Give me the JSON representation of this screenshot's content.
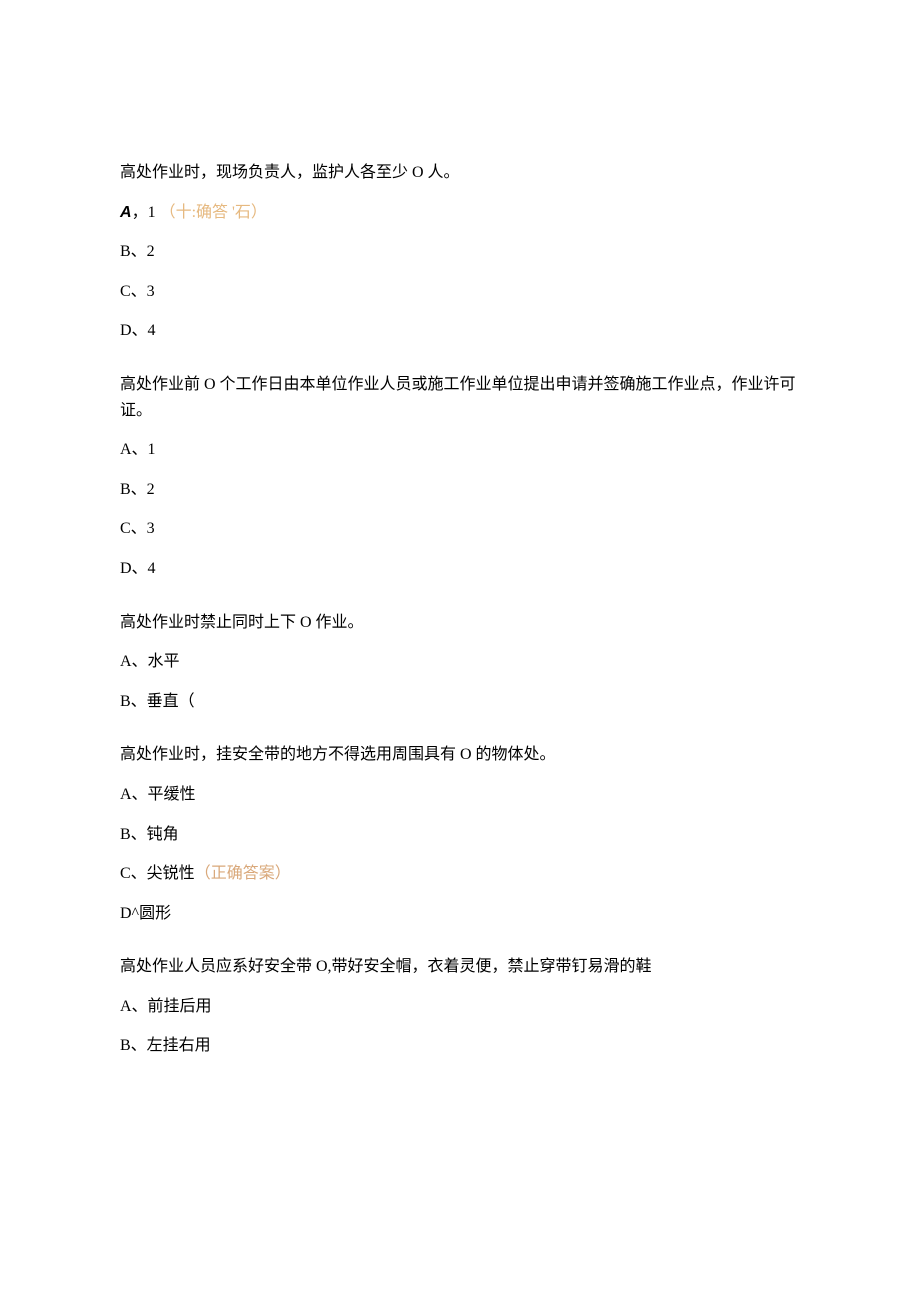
{
  "q1": {
    "text": "高处作业时，现场负责人，监护人各至少 O 人。",
    "a_prefix": "A",
    "a_sep": "，",
    "a_val": "1",
    "a_correct": "（十:确答 '石）",
    "b": "B、2",
    "c": "C、3",
    "d": "D、4"
  },
  "q2": {
    "text": "高处作业前 O 个工作日由本单位作业人员或施工作业单位提出申请并签确施工作业点，作业许可证。",
    "a": "A、1",
    "b": "B、2",
    "c": "C、3",
    "d": "D、4"
  },
  "q3": {
    "text": "高处作业时禁止同时上下 O 作业。",
    "a": "A、水平",
    "b": "B、垂直（"
  },
  "q4": {
    "text": "高处作业时，挂安全带的地方不得选用周围具有 O 的物体处。",
    "a": "A、平缓性",
    "b": "B、钝角",
    "c_label": "C、尖锐性",
    "c_correct": "（正确答案）",
    "d": "D^圆形"
  },
  "q5": {
    "text": "高处作业人员应系好安全带 O,带好安全帽，衣着灵便，禁止穿带钉易滑的鞋",
    "a": "A、前挂后用",
    "b": "B、左挂右用"
  }
}
